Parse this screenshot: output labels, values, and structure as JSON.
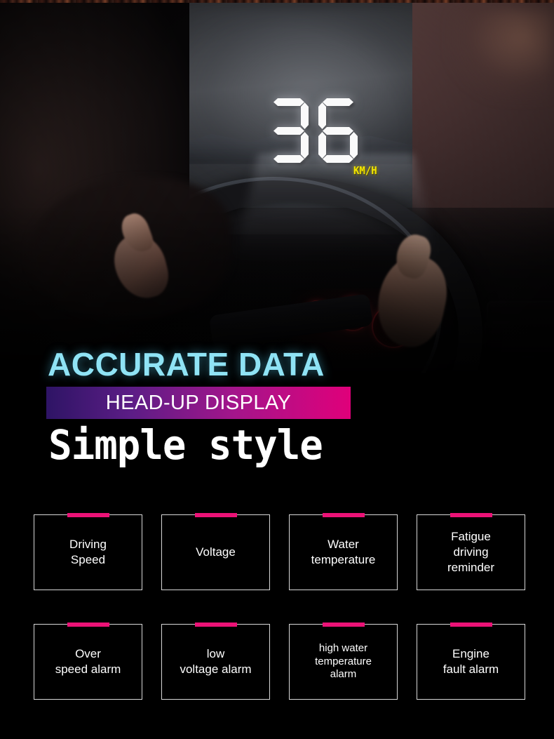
{
  "hud": {
    "speed": "36",
    "unit": "KM/H"
  },
  "headline": {
    "line1": "ACCURATE DATA",
    "line2": "HEAD-UP DISPLAY",
    "line3": "Simple style"
  },
  "colors": {
    "accurate_cyan": "#8fe3f5",
    "bar_gradient_start": "#2e1465",
    "bar_gradient_end": "#e0007a",
    "tick_pink": "#ec1277",
    "unit_yellow": "#f2e400",
    "box_border": "#d8d8d8",
    "background": "#000000"
  },
  "features": [
    {
      "label": "Driving\nSpeed",
      "small": false
    },
    {
      "label": "Voltage",
      "small": false
    },
    {
      "label": "Water\ntemperature",
      "small": false
    },
    {
      "label": "Fatigue\ndriving\nreminder",
      "small": false
    },
    {
      "label": "Over\nspeed alarm",
      "small": false
    },
    {
      "label": "low\nvoltage alarm",
      "small": false
    },
    {
      "label": "high water\ntemperature\nalarm",
      "small": true
    },
    {
      "label": "Engine\nfault alarm",
      "small": false
    }
  ]
}
